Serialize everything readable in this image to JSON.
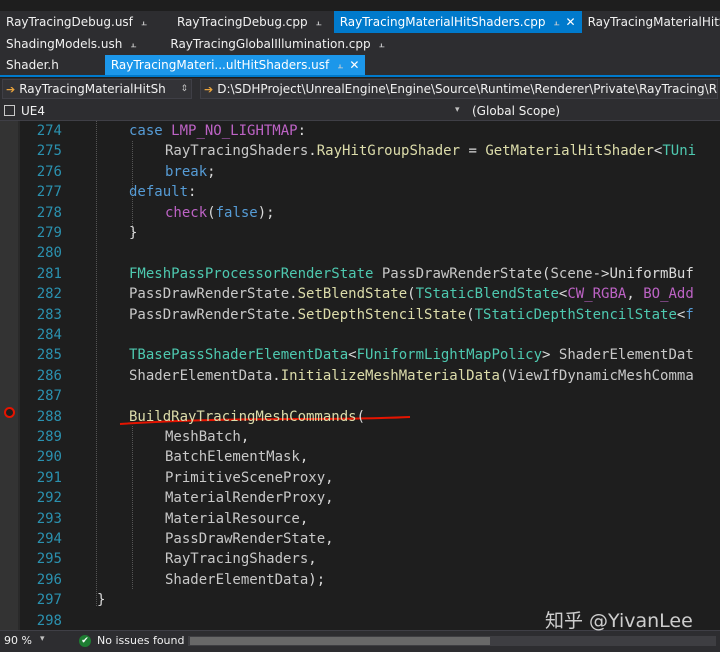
{
  "tabs": {
    "row1": [
      {
        "label": "RayTracingDebug.usf",
        "pin": "📌",
        "active": false
      },
      {
        "label": "RayTracingDebug.cpp",
        "pin": "📌",
        "active": false
      },
      {
        "label": "RayTracingMaterialHitShaders.cpp",
        "pin": "📌",
        "close": "✕",
        "active": true
      },
      {
        "label": "RayTracingMaterialHitSha",
        "active": false
      }
    ],
    "row2": [
      {
        "label": "ShadingModels.ush",
        "pin": "📌"
      },
      {
        "label": "RayTracingGlobalIllumination.cpp",
        "pin": "📌"
      }
    ],
    "row3": [
      {
        "label": "Shader.h"
      },
      {
        "label": "RayTracingMateri...ultHitShaders.usf",
        "pin": "📌",
        "close": "✕"
      }
    ]
  },
  "navbar": {
    "class_combo": "RayTracingMaterialHitSh",
    "path_combo": "D:\\SDHProject\\UnrealEngine\\Engine\\Source\\Runtime\\Renderer\\Private\\RayTracing\\RayTracingMaterialHitShaders.cpp",
    "project_combo": "UE4",
    "scope_combo": "(Global Scope)"
  },
  "code_lines": [
    {
      "n": "274",
      "tokens": [
        [
          "kw",
          "case "
        ],
        [
          "mac",
          "LMP_NO_LIGHTMAP"
        ],
        [
          "id",
          ":"
        ]
      ],
      "indent": 1
    },
    {
      "n": "275",
      "tokens": [
        [
          "param",
          "RayTracingShaders"
        ],
        [
          "id",
          "."
        ],
        [
          "mem",
          "RayHitGroupShader"
        ],
        [
          "id",
          " = "
        ],
        [
          "fn",
          "GetMaterialHitShader"
        ],
        [
          "id",
          "<"
        ],
        [
          "ty",
          "TUni"
        ]
      ],
      "indent": 2
    },
    {
      "n": "276",
      "tokens": [
        [
          "kw",
          "break"
        ],
        [
          "id",
          ";"
        ]
      ],
      "indent": 2
    },
    {
      "n": "277",
      "tokens": [
        [
          "kw",
          "default"
        ],
        [
          "id",
          ":"
        ]
      ],
      "indent": 1
    },
    {
      "n": "278",
      "tokens": [
        [
          "mac",
          "check"
        ],
        [
          "id",
          "("
        ],
        [
          "kw",
          "false"
        ],
        [
          "id",
          ");"
        ]
      ],
      "indent": 2
    },
    {
      "n": "279",
      "tokens": [
        [
          "id",
          "}"
        ]
      ],
      "indent": 1
    },
    {
      "n": "280",
      "tokens": [],
      "indent": 1
    },
    {
      "n": "281",
      "tokens": [
        [
          "ty",
          "FMeshPassProcessorRenderState "
        ],
        [
          "param",
          "PassDrawRenderState"
        ],
        [
          "id",
          "("
        ],
        [
          "param",
          "Scene"
        ],
        [
          "id",
          "->"
        ],
        [
          "id",
          "UniformBuf"
        ]
      ],
      "indent": 1
    },
    {
      "n": "282",
      "tokens": [
        [
          "param",
          "PassDrawRenderState"
        ],
        [
          "id",
          "."
        ],
        [
          "fn",
          "SetBlendState"
        ],
        [
          "id",
          "("
        ],
        [
          "ty",
          "TStaticBlendState"
        ],
        [
          "id",
          "<"
        ],
        [
          "mac",
          "CW_RGBA"
        ],
        [
          "id",
          ", "
        ],
        [
          "mac",
          "BO_Add"
        ]
      ],
      "indent": 1
    },
    {
      "n": "283",
      "tokens": [
        [
          "param",
          "PassDrawRenderState"
        ],
        [
          "id",
          "."
        ],
        [
          "fn",
          "SetDepthStencilState"
        ],
        [
          "id",
          "("
        ],
        [
          "ty",
          "TStaticDepthStencilState"
        ],
        [
          "id",
          "<"
        ],
        [
          "kw",
          "f"
        ]
      ],
      "indent": 1
    },
    {
      "n": "284",
      "tokens": [],
      "indent": 1
    },
    {
      "n": "285",
      "tokens": [
        [
          "ty",
          "TBasePassShaderElementData"
        ],
        [
          "id",
          "<"
        ],
        [
          "ty",
          "FUniformLightMapPolicy"
        ],
        [
          "id",
          "> "
        ],
        [
          "param",
          "ShaderElementDat"
        ]
      ],
      "indent": 1
    },
    {
      "n": "286",
      "tokens": [
        [
          "param",
          "ShaderElementData"
        ],
        [
          "id",
          "."
        ],
        [
          "fn",
          "InitializeMeshMaterialData"
        ],
        [
          "id",
          "("
        ],
        [
          "param",
          "ViewIfDynamicMeshComma"
        ]
      ],
      "indent": 1
    },
    {
      "n": "287",
      "tokens": [],
      "indent": 1
    },
    {
      "n": "288",
      "tokens": [
        [
          "fn",
          "BuildRayTracingMeshCommands"
        ],
        [
          "id",
          "("
        ]
      ],
      "indent": 1
    },
    {
      "n": "289",
      "tokens": [
        [
          "param",
          "MeshBatch"
        ],
        [
          "id",
          ","
        ]
      ],
      "indent": 2
    },
    {
      "n": "290",
      "tokens": [
        [
          "param",
          "BatchElementMask"
        ],
        [
          "id",
          ","
        ]
      ],
      "indent": 2
    },
    {
      "n": "291",
      "tokens": [
        [
          "param",
          "PrimitiveSceneProxy"
        ],
        [
          "id",
          ","
        ]
      ],
      "indent": 2
    },
    {
      "n": "292",
      "tokens": [
        [
          "param",
          "MaterialRenderProxy"
        ],
        [
          "id",
          ","
        ]
      ],
      "indent": 2
    },
    {
      "n": "293",
      "tokens": [
        [
          "param",
          "MaterialResource"
        ],
        [
          "id",
          ","
        ]
      ],
      "indent": 2
    },
    {
      "n": "294",
      "tokens": [
        [
          "param",
          "PassDrawRenderState"
        ],
        [
          "id",
          ","
        ]
      ],
      "indent": 2
    },
    {
      "n": "295",
      "tokens": [
        [
          "param",
          "RayTracingShaders"
        ],
        [
          "id",
          ","
        ]
      ],
      "indent": 2
    },
    {
      "n": "296",
      "tokens": [
        [
          "param",
          "ShaderElementData"
        ],
        [
          "id",
          ");"
        ]
      ],
      "indent": 2
    },
    {
      "n": "297",
      "tokens": [
        [
          "id",
          "}"
        ]
      ],
      "indent": 0
    },
    {
      "n": "298",
      "tokens": [],
      "indent": 0
    }
  ],
  "status": {
    "zoom": "90 %",
    "zoom_caret": "▾",
    "issues_icon": "✔",
    "issues_text": "No issues found"
  },
  "watermark": "知乎 @YivanLee",
  "colors": {
    "accent": "#007acc",
    "editor_bg": "#1e1e1e",
    "line_numbers": "#2b91af",
    "annotation_underline": "#e51400"
  }
}
